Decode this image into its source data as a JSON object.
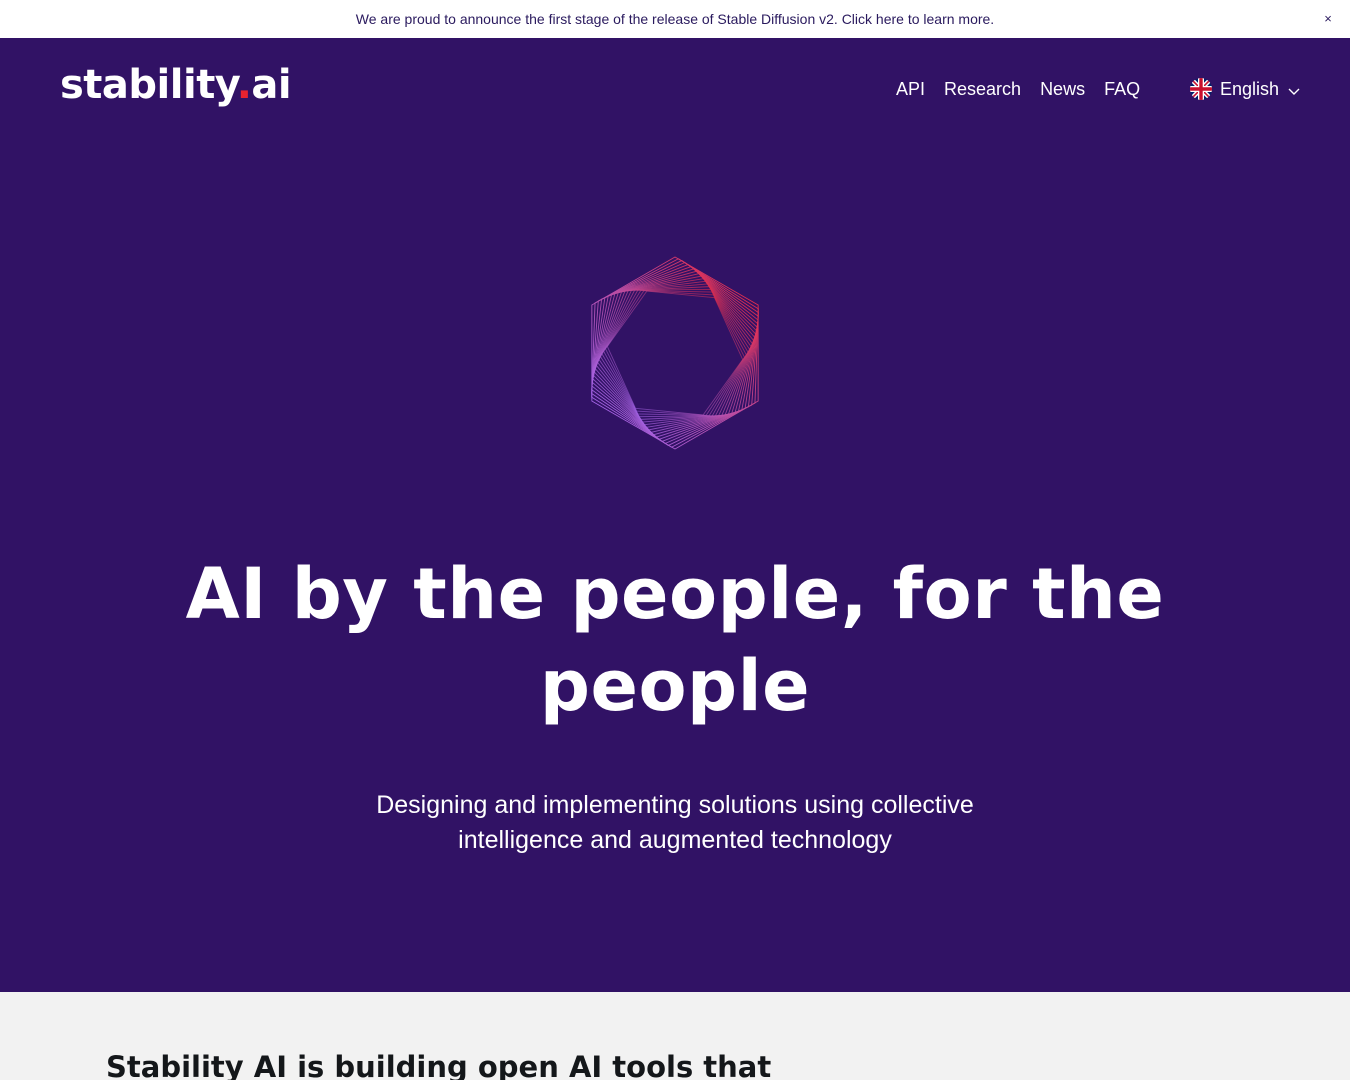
{
  "announcement": {
    "text": "We are proud to announce the first stage of the release of Stable Diffusion v2. Click here to learn more.",
    "close_label": "×"
  },
  "header": {
    "logo_main": "stability",
    "logo_dot": ".",
    "logo_suffix": "ai",
    "nav": [
      {
        "label": "API"
      },
      {
        "label": "Research"
      },
      {
        "label": "News"
      },
      {
        "label": "FAQ"
      }
    ],
    "language": {
      "label": "English",
      "flag_icon": "uk-flag-icon",
      "chevron_icon": "chevron-down-icon"
    }
  },
  "hero": {
    "headline": "AI by the people, for the people",
    "subtitle": "Designing and implementing solutions using collective intelligence and augmented technology"
  },
  "section": {
    "heading": "Stability AI is building open AI tools that"
  },
  "colors": {
    "hero_bg": "#311265",
    "accent_red": "#e8232f",
    "accent_violet": "#9b6bff",
    "announcement_text": "#2a1a5e",
    "lower_bg": "#f2f2f2"
  }
}
